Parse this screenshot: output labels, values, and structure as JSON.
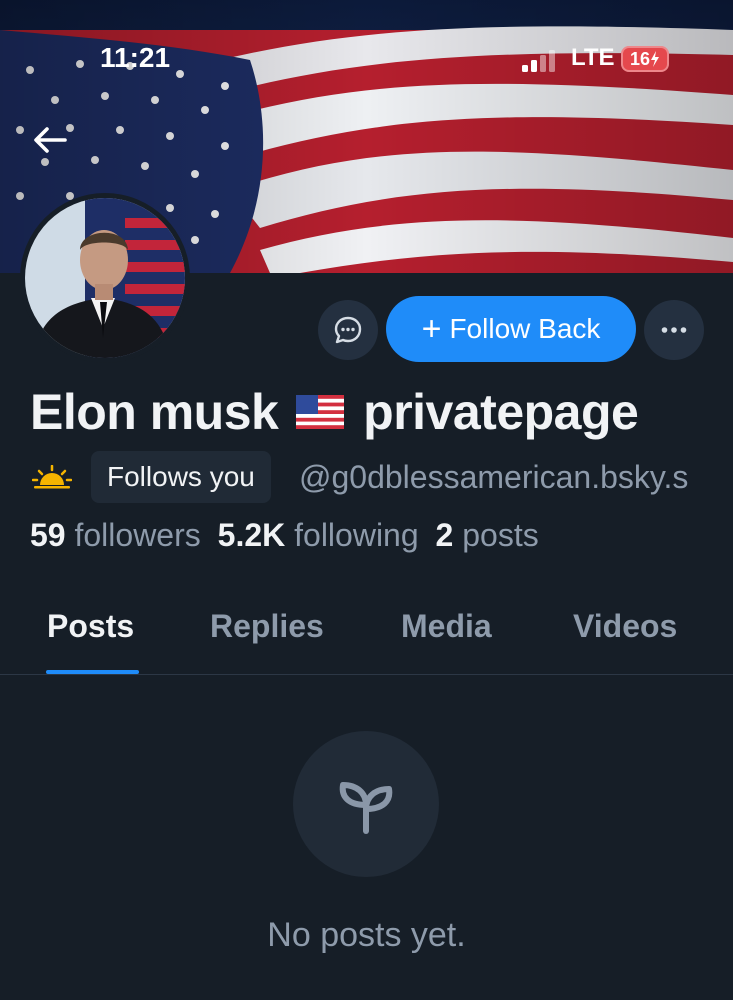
{
  "status_bar": {
    "time": "11:21",
    "network": "LTE",
    "battery": "16"
  },
  "profile": {
    "display_name_part1": "Elon musk",
    "display_name_part2": "privatepage",
    "follows_you": "Follows you",
    "handle": "@g0dblessamerican.bsky.s",
    "stats": {
      "followers_count": "59",
      "followers_label": "followers",
      "following_count": "5.2K",
      "following_label": "following",
      "posts_count": "2",
      "posts_label": "posts"
    }
  },
  "actions": {
    "follow_back_label": "Follow Back"
  },
  "tabs": [
    {
      "label": "Posts",
      "active": true
    },
    {
      "label": "Replies",
      "active": false
    },
    {
      "label": "Media",
      "active": false
    },
    {
      "label": "Videos",
      "active": false
    }
  ],
  "empty_state": {
    "message": "No posts yet."
  },
  "colors": {
    "background": "#161e27",
    "accent": "#1f8cf9",
    "muted_text": "#8e9bab",
    "battery_red": "#e5484d"
  },
  "icons": [
    "back-arrow-icon",
    "message-icon",
    "plus-icon",
    "more-icon",
    "sun-icon",
    "flag-emoji-icon",
    "seedling-icon"
  ]
}
